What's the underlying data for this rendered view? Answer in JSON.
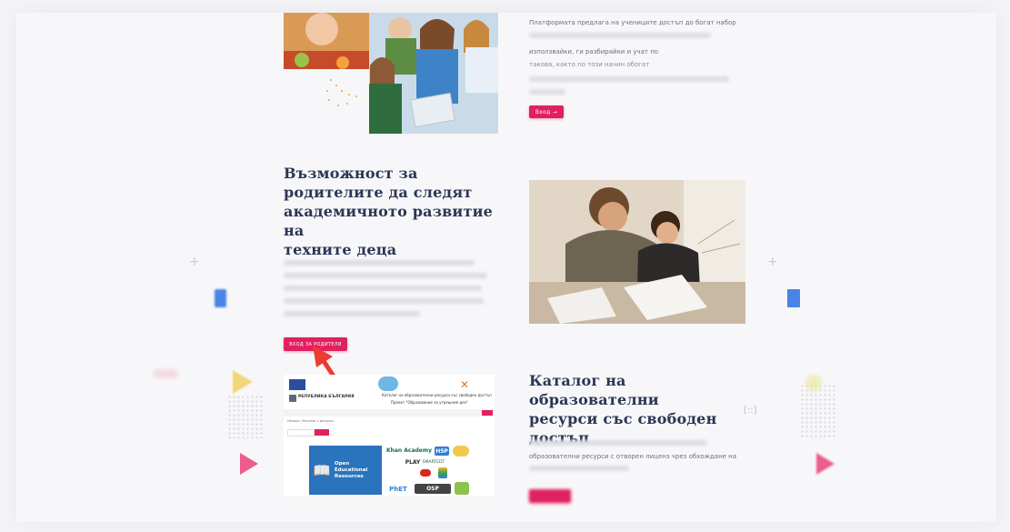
{
  "section1": {
    "paragraph_lines": [
      "Платформата предлага на учениците достъп до богат набор",
      "",
      "използвайки, ги разбирайки и учат по",
      "такова, както по този начин обогат"
    ],
    "button_label": "Вход →"
  },
  "section2": {
    "heading_lines": [
      "Възможност за",
      "родителите да следят",
      "академичното развитие на",
      "техните деца"
    ],
    "button_label": "ВХОД ЗА РОДИТЕЛИ"
  },
  "section3": {
    "heading_lines": [
      "Каталог на образователни",
      "ресурси със свободен",
      "достъп"
    ],
    "paragraph_lines": [
      "",
      "образователни ресурси с отворен лиценз чрез обхождане на"
    ]
  },
  "catalog_screenshot": {
    "org_title": "РЕПУБЛИКА БЪЛГАРИЯ",
    "project_title": "Каталог на образователни ресурси със свободен достъп",
    "project_subtitle": "Проект \"Образование за утрешния ден\"",
    "breadcrumb": "Начало / Каталог с ресурси",
    "oer_label": "Open Educational Resources",
    "logos": [
      "Khan Academy",
      "H5P",
      "PLAY",
      "SMARTEDT",
      "PhET",
      "OSP"
    ]
  },
  "colors": {
    "accent": "#e0215f",
    "heading": "#2b3654",
    "blue_deco": "#4a84e8"
  }
}
